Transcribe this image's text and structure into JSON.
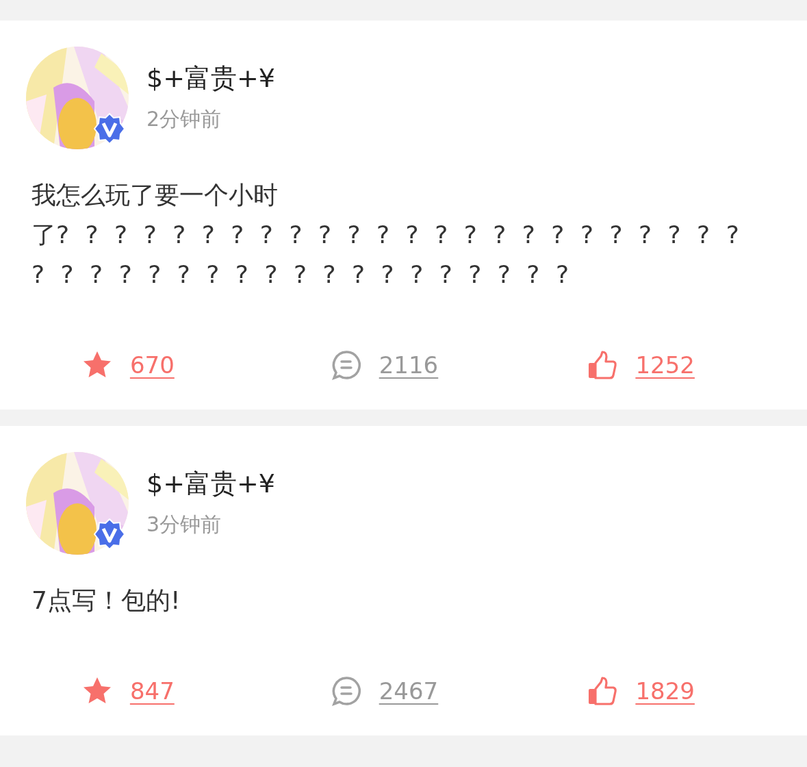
{
  "posts": [
    {
      "author": {
        "name": "$+富贵+¥",
        "verified": true
      },
      "time": "2分钟前",
      "text_lines": [
        "我怎么玩了要一个小时",
        "了? ? ? ? ? ? ? ? ? ? ? ? ? ? ? ? ? ? ? ? ? ? ? ? ? ? ? ? ? ? ? ? ? ? ? ? ? ? ? ? ? ? ?"
      ],
      "actions": [
        {
          "kind": "star",
          "count": "670",
          "active": true
        },
        {
          "kind": "comment",
          "count": "2116",
          "active": false
        },
        {
          "kind": "like",
          "count": "1252",
          "active": true
        }
      ]
    },
    {
      "author": {
        "name": "$+富贵+¥",
        "verified": true
      },
      "time": "3分钟前",
      "text_lines": [
        "7点写！包的!"
      ],
      "actions": [
        {
          "kind": "star",
          "count": "847",
          "active": true
        },
        {
          "kind": "comment",
          "count": "2467",
          "active": false
        },
        {
          "kind": "like",
          "count": "1829",
          "active": true
        }
      ]
    }
  ]
}
